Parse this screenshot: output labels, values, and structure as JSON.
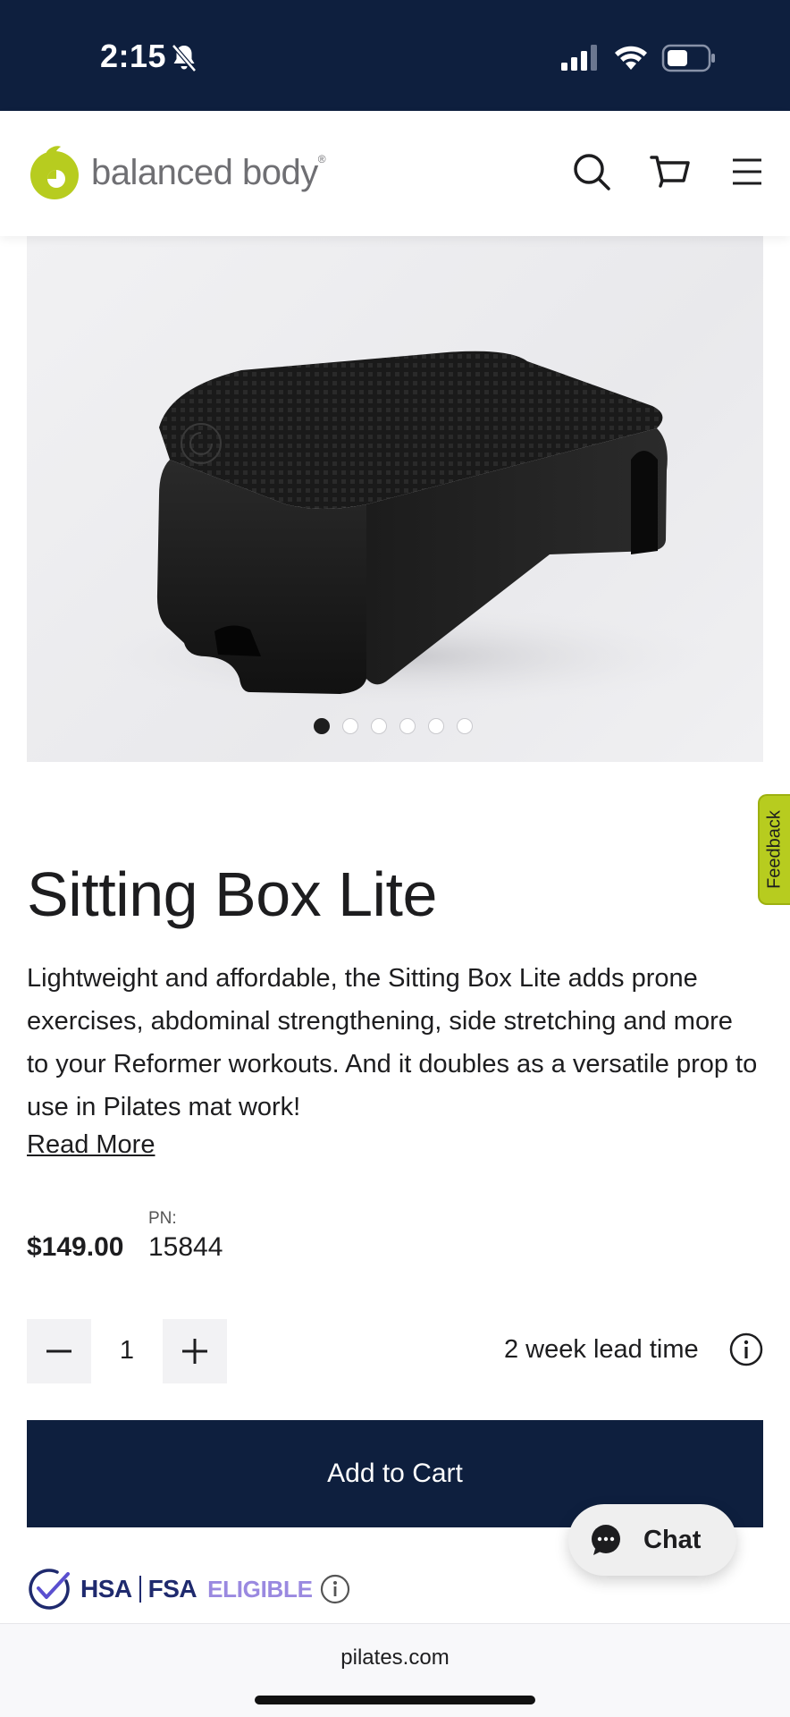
{
  "status_bar": {
    "time": "2:15",
    "icons": [
      "bell-slash-icon",
      "signal-icon",
      "wifi-icon",
      "battery-icon"
    ]
  },
  "header": {
    "logo_text": "balanced body",
    "logo_reg": "®",
    "icons": [
      "search-icon",
      "cart-icon",
      "menu-icon"
    ]
  },
  "gallery": {
    "image_count": 6,
    "active_index": 0
  },
  "feedback": {
    "label": "Feedback"
  },
  "product": {
    "title": "Sitting Box Lite",
    "description": "Lightweight and affordable, the Sitting Box Lite adds prone exercises, abdominal strengthening, side stretching and more to your Reformer workouts. And it doubles as a versatile prop to use in Pilates mat work!",
    "read_more": "Read More",
    "price": "$149.00",
    "pn_label": "PN:",
    "pn_value": "15844"
  },
  "purchase": {
    "quantity": "1",
    "lead_time": "2 week lead time",
    "add_to_cart": "Add to Cart"
  },
  "chat": {
    "label": "Chat"
  },
  "hsa": {
    "hsa": "HSA",
    "fsa": "FSA",
    "eligible": "ELIGIBLE"
  },
  "browser": {
    "url": "pilates.com"
  },
  "colors": {
    "navy": "#0e1f3e",
    "brand_green": "#b7cc1f",
    "hsa_blue": "#1f2a6e",
    "eligible_purple": "#9a89e0"
  }
}
